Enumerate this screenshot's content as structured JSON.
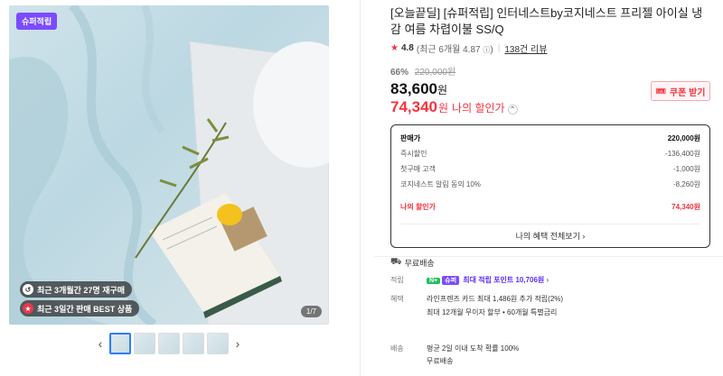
{
  "gallery": {
    "badge": "슈퍼적립",
    "pill1": "최근 3개월간 27명 재구매",
    "pill2": "최근 3일간 판매 BEST 상품",
    "counter": "1/7",
    "thumb_count": 5
  },
  "product": {
    "title": "[오늘끝딜] [슈퍼적립] 인터네스트by코지네스트 프리젤 아이실 냉감 여름 차렵이불 SS/Q",
    "rating": "4.8",
    "rating_recent": "(최근 6개월 4.87",
    "reviews": "138건 리뷰",
    "discount_pct": "66%",
    "original_price": "220,000원",
    "price": "83,600",
    "my_price": "74,340",
    "won": "원",
    "my_price_label": "나의 할인가",
    "coupon": "쿠폰 받기"
  },
  "pricebox": {
    "rows": [
      {
        "label": "판매가",
        "value": "220,000원"
      },
      {
        "label": "즉시할인",
        "value": "-136,400원"
      },
      {
        "label": "첫구매 고객",
        "value": "-1,000원"
      },
      {
        "label": "코지네스트 알림 동의 10%",
        "value": "-8,260원"
      }
    ],
    "mine_label": "나의 할인가",
    "mine_value": "74,340원",
    "more": "나의 혜택 전체보기"
  },
  "shipping": {
    "free": "무료배송"
  },
  "info": {
    "points_key": "적립",
    "points_value": "최대 적립 포인트 10,706원",
    "benefit_key": "혜택",
    "benefit_1": "라인프렌즈 카드 최대 1,486원 추가 적립(2%)",
    "benefit_2": "최대 12개월 무이자 할부 • 60개월 특별금리",
    "delivery_key": "배송",
    "delivery_1": "평균 2일 이내 도착 확률 100%",
    "delivery_2": "무료배송"
  },
  "colors": {
    "accent": "#f5333f",
    "super": "#7b4bff",
    "npay": "#20c05c"
  }
}
